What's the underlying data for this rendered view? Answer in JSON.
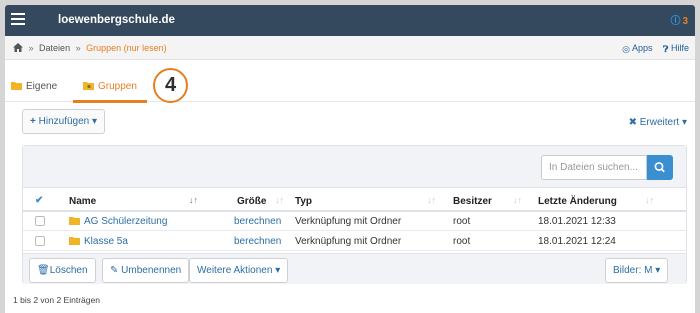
{
  "header": {
    "title": "loewenbergschule.de",
    "notification_count": "3"
  },
  "breadcrumb": {
    "items": [
      "Dateien",
      "Gruppen (nur lesen)"
    ],
    "separator": "»"
  },
  "top_links": {
    "apps": "Apps",
    "help": "Hilfe"
  },
  "tabs": [
    {
      "label": "Eigene"
    },
    {
      "label": "Gruppen"
    }
  ],
  "annotation": {
    "number": "4"
  },
  "toolbar": {
    "add_label": "Hinzufügen",
    "advanced_label": "Erweitert"
  },
  "search": {
    "placeholder": "In Dateien suchen..."
  },
  "table": {
    "columns": [
      "Name",
      "Größe",
      "Typ",
      "Besitzer",
      "Letzte Änderung"
    ],
    "rows": [
      {
        "name": "AG Schülerzeitung",
        "size": "berechnen",
        "type": "Verknüpfung mit Ordner",
        "owner": "root",
        "modified": "18.01.2021 12:33"
      },
      {
        "name": "Klasse 5a",
        "size": "berechnen",
        "type": "Verknüpfung mit Ordner",
        "owner": "root",
        "modified": "18.01.2021 12:24"
      }
    ]
  },
  "actions": {
    "delete": "Löschen",
    "rename": "Umbenennen",
    "more": "Weitere Aktionen",
    "images": "Bilder: M"
  },
  "footer": {
    "count_text": "1 bis 2 von 2 Einträgen"
  },
  "colors": {
    "header_bg": "#34495e",
    "accent": "#e67e22",
    "link": "#2d6ea5",
    "primary_button": "#3a8fd1"
  }
}
